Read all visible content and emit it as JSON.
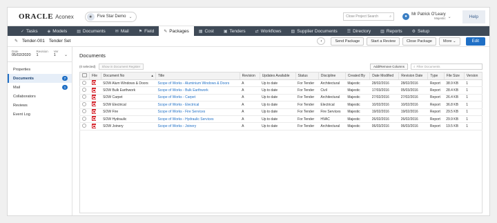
{
  "header": {
    "brand": "ORACLE",
    "product": "Aconex",
    "project_name": "Five Star Demo",
    "search_placeholder": "Close Project Search",
    "user_name": "Mr Patrick O'Leary",
    "user_org": "Majestic",
    "help_label": "Help"
  },
  "nav": {
    "items": [
      {
        "label": "Tasks",
        "icon": "check-icon"
      },
      {
        "label": "Models",
        "icon": "cube-icon"
      },
      {
        "label": "Documents",
        "icon": "document-icon"
      },
      {
        "label": "Mail",
        "icon": "mail-icon"
      },
      {
        "label": "Field",
        "icon": "field-icon"
      },
      {
        "label": "Packages",
        "icon": "package-icon",
        "active": true
      },
      {
        "label": "Cost",
        "icon": "cost-icon"
      },
      {
        "label": "Tenders",
        "icon": "tenders-icon"
      },
      {
        "label": "Workflows",
        "icon": "workflow-icon"
      },
      {
        "label": "Supplier Documents",
        "icon": "supplier-icon"
      },
      {
        "label": "Directory",
        "icon": "directory-icon"
      },
      {
        "label": "Reports",
        "icon": "reports-icon"
      },
      {
        "label": "Setup",
        "icon": "gear-icon"
      }
    ]
  },
  "toolbar": {
    "record_id": "Tender-001",
    "record_name": "Tender Set",
    "send_package": "Send Package",
    "start_review": "Start a Review",
    "close_package": "Close Package",
    "more": "More",
    "edit": "Edit"
  },
  "sidebar": {
    "date_label": "Date",
    "date_value": "05/02/2020",
    "revision_label": "Revision",
    "revision_value": "1",
    "ver_label": "Ver",
    "ver_value": "1",
    "items": [
      {
        "label": "Properties",
        "badge": ""
      },
      {
        "label": "Documents",
        "badge": "7",
        "active": true
      },
      {
        "label": "Mail",
        "badge": "1"
      },
      {
        "label": "Collaborators",
        "badge": ""
      },
      {
        "label": "Reviews",
        "badge": ""
      },
      {
        "label": "Event Log",
        "badge": ""
      }
    ]
  },
  "documents": {
    "title": "Documents",
    "selected_count": "(0 selected)",
    "show_register": "Show in Document Register",
    "add_remove_columns": "Add/Remove Columns",
    "filter_placeholder": "Filter Documents",
    "columns": [
      "File",
      "Document No",
      "Title",
      "Revision",
      "Updates Available",
      "Status",
      "Discipline",
      "Created By",
      "Date Modified",
      "Revision Date",
      "Type",
      "File Size",
      "Version"
    ],
    "rows": [
      {
        "doc_no": "SOW Alum Windows & Doors",
        "title": "Scope of Works - Aluminium Windows & Doors",
        "revision": "A",
        "updates": "Up to date",
        "status": "For Tender",
        "discipline": "Architectural",
        "created_by": "Majestic",
        "date_modified": "28/02/2016",
        "revision_date": "28/02/2016",
        "type": "Report",
        "file_size": "38.9 KB",
        "version": "1"
      },
      {
        "doc_no": "SOW Bulk Earthwork",
        "title": "Scope of Works - Bulk Earthwork",
        "revision": "A",
        "updates": "Up to date",
        "status": "For Tender",
        "discipline": "Civil",
        "created_by": "Majestic",
        "date_modified": "17/03/2016",
        "revision_date": "05/03/2016",
        "type": "Report",
        "file_size": "28.4 KB",
        "version": "1"
      },
      {
        "doc_no": "SOW Carpet",
        "title": "Scope of Works - Carpet",
        "revision": "A",
        "updates": "Up to date",
        "status": "For Tender",
        "discipline": "Architectural",
        "created_by": "Majestic",
        "date_modified": "27/02/2016",
        "revision_date": "27/02/2016",
        "type": "Report",
        "file_size": "26.4 KB",
        "version": "1"
      },
      {
        "doc_no": "SOW Electrical",
        "title": "Scope of Works - Electrical",
        "revision": "A",
        "updates": "Up to date",
        "status": "For Tender",
        "discipline": "Electrical",
        "created_by": "Majestic",
        "date_modified": "10/02/2016",
        "revision_date": "10/02/2016",
        "type": "Report",
        "file_size": "36.8 KB",
        "version": "1"
      },
      {
        "doc_no": "SOW Fire",
        "title": "Scope of Works - Fire Services",
        "revision": "A",
        "updates": "Up to date",
        "status": "For Tender",
        "discipline": "Fire Services",
        "created_by": "Majestic",
        "date_modified": "19/02/2016",
        "revision_date": "19/02/2016",
        "type": "Report",
        "file_size": "29.5 KB",
        "version": "1"
      },
      {
        "doc_no": "SOW Hydraulic",
        "title": "Scope of Works - Hydraulic Services",
        "revision": "A",
        "updates": "Up to date",
        "status": "For Tender",
        "discipline": "HVAC",
        "created_by": "Majestic",
        "date_modified": "26/02/2016",
        "revision_date": "26/02/2016",
        "type": "Report",
        "file_size": "29.9 KB",
        "version": "1"
      },
      {
        "doc_no": "SOW Joinery",
        "title": "Scope of Works - Joinery",
        "revision": "A",
        "updates": "Up to date",
        "status": "For Tender",
        "discipline": "Architectural",
        "created_by": "Majestic",
        "date_modified": "06/03/2016",
        "revision_date": "06/03/2016",
        "type": "Report",
        "file_size": "19.5 KB",
        "version": "1"
      }
    ]
  },
  "colors": {
    "nav_bg": "#3f4a57",
    "accent": "#1f6fc5",
    "pdf_red": "#d6262e"
  }
}
